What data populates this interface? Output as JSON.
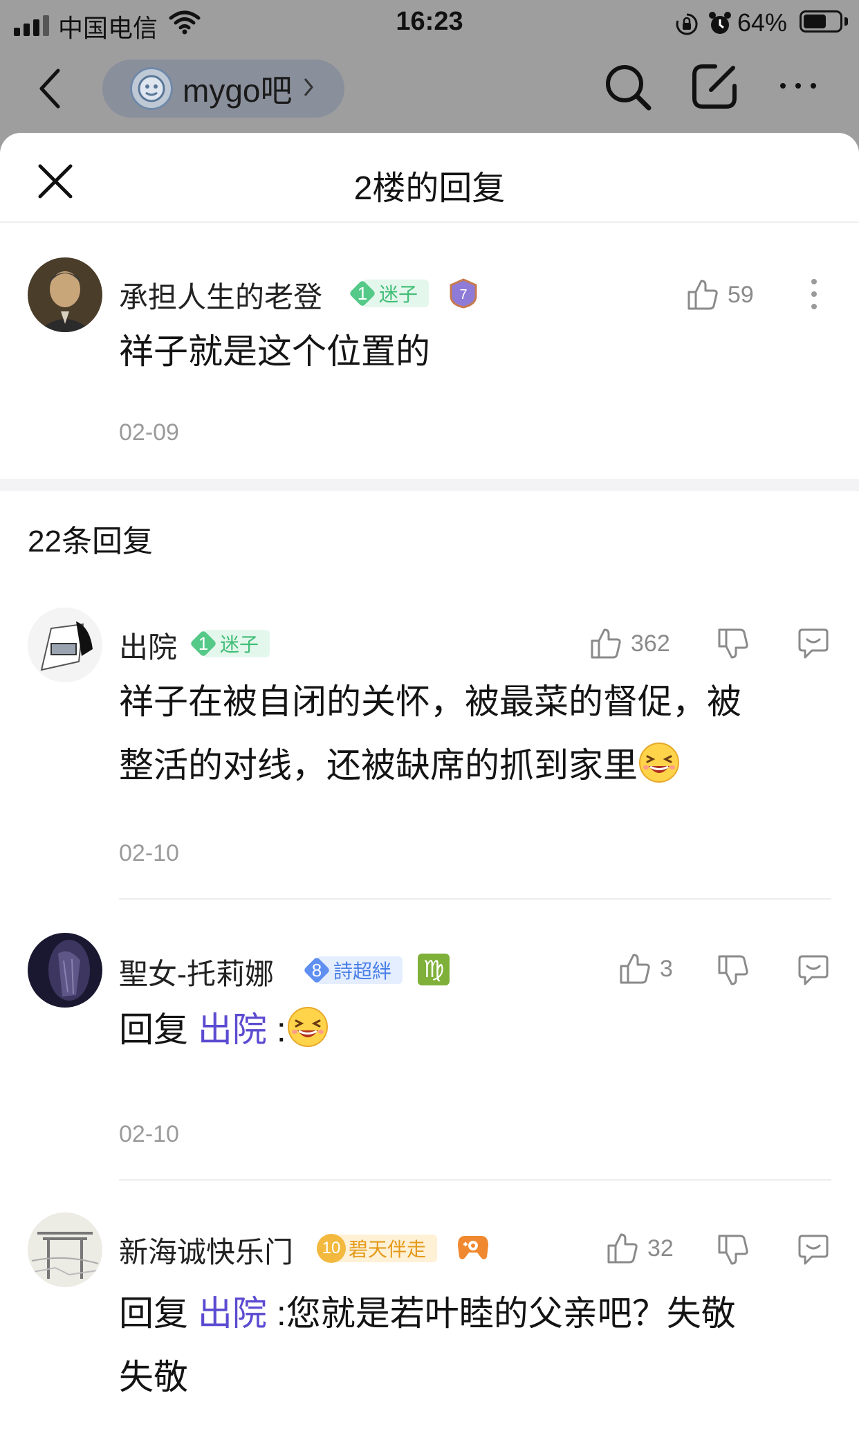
{
  "status_bar": {
    "carrier": "中国电信",
    "time": "16:23",
    "battery_pct": "64%",
    "battery_level": 0.64
  },
  "nav": {
    "forum_name": "mygo吧"
  },
  "sheet": {
    "title": "2楼的回复"
  },
  "main_post": {
    "username": "承担人生的老登",
    "level": "1",
    "level_title": "迷子",
    "badge_extra": "7",
    "likes": "59",
    "text": "祥子就是这个位置的",
    "date": "02-09"
  },
  "replies_header": {
    "count_label": "22条回复"
  },
  "replies": [
    {
      "username": "出院",
      "level": "1",
      "level_title": "迷子",
      "likes": "362",
      "text_line1": "祥子在被自闭的关怀，被最菜的督促，被",
      "text_line2": "整活的对线，还被缺席的抓到家里",
      "date": "02-10"
    },
    {
      "username": "聖女-托莉娜",
      "level": "8",
      "level_title": "詩超絆",
      "zodiac": "♍",
      "likes": "3",
      "reply_prefix": "回复",
      "reply_target": "出院",
      "reply_sep": ":",
      "date": "02-10"
    },
    {
      "username": "新海诚快乐门",
      "level": "10",
      "level_title": "碧天伴走",
      "likes": "32",
      "reply_prefix": "回复",
      "reply_target": "出院",
      "text_line1": ":您就是若叶睦的父亲吧？失敬",
      "text_line2": "失敬"
    }
  ],
  "colors": {
    "backdrop": "#9e9e9e",
    "reply_link": "#5b4bd1",
    "level_green": "#54c988",
    "level_blue": "#5f8ff0",
    "level_gold": "#f3b93e"
  }
}
